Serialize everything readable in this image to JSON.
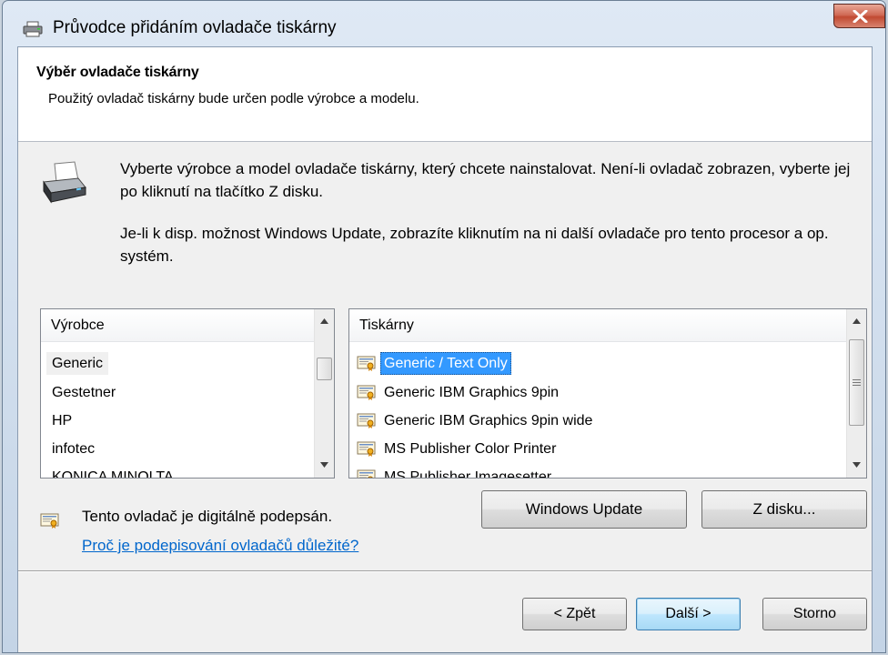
{
  "window": {
    "title": "Průvodce přidáním ovladače tiskárny"
  },
  "header": {
    "title": "Výběr ovladače tiskárny",
    "subtitle": "Použitý ovladač tiskárny bude určen podle výrobce a modelu."
  },
  "intro": {
    "p1": "Vyberte výrobce a model ovladače tiskárny, který chcete nainstalovat. Není-li ovladač zobrazen, vyberte jej po kliknutí na tlačítko Z disku.",
    "p2": "Je-li k disp. možnost Windows Update, zobrazíte kliknutím na ni další ovladače pro tento procesor a op. systém."
  },
  "manufacturers": {
    "header": "Výrobce",
    "items": [
      "Generic",
      "Gestetner",
      "HP",
      "infotec",
      "KONICA MINOLTA"
    ],
    "selected_index": 0
  },
  "printers": {
    "header": "Tiskárny",
    "items": [
      "Generic / Text Only",
      "Generic IBM Graphics 9pin",
      "Generic IBM Graphics 9pin wide",
      "MS Publisher Color Printer",
      "MS Publisher Imagesetter"
    ],
    "selected_index": 0
  },
  "signed": {
    "text": "Tento ovladač je digitálně podepsán.",
    "link": "Proč je podepisování ovladačů důležité?"
  },
  "buttons": {
    "windows_update": "Windows Update",
    "have_disk": "Z disku...",
    "back": "< Zpět",
    "next": "Další >",
    "cancel": "Storno"
  },
  "colors": {
    "selection": "#3399ff",
    "link": "#0066cc",
    "close_button": "#c94c35"
  }
}
